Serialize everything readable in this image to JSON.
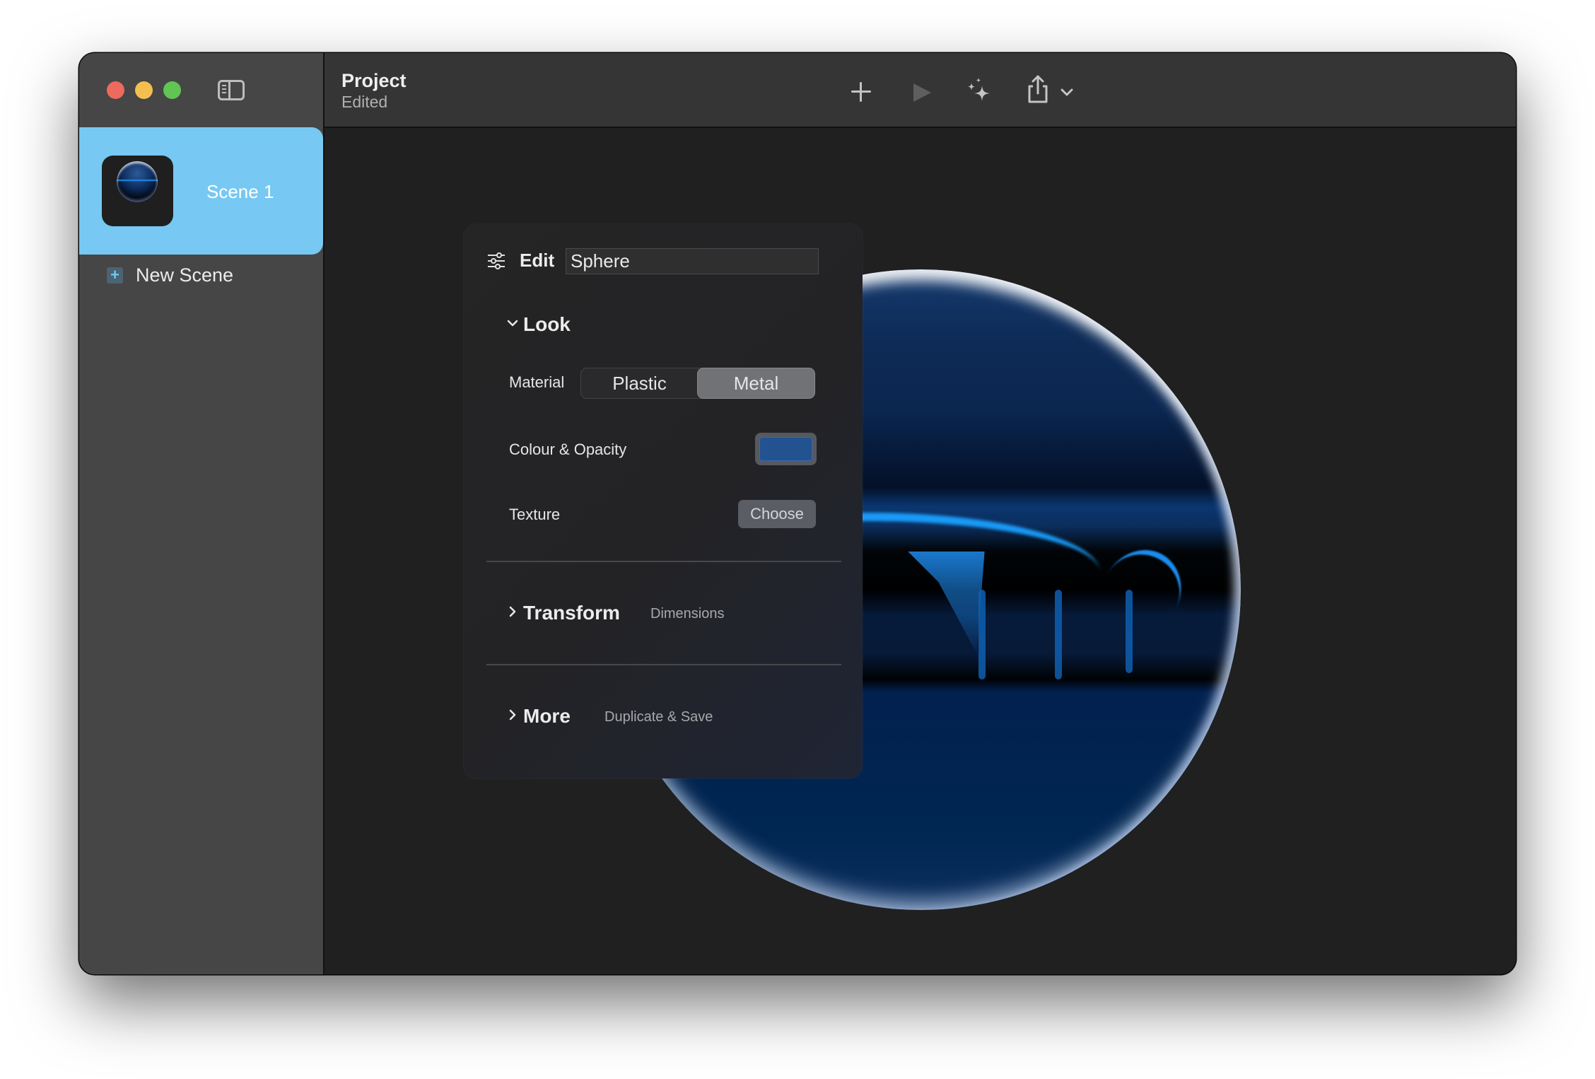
{
  "window": {
    "traffic_lights": [
      "close",
      "minimize",
      "maximize"
    ],
    "title": "Project",
    "subtitle": "Edited"
  },
  "sidebar": {
    "toggle_icon": "sidebar-icon",
    "scenes": [
      {
        "label": "Scene 1",
        "selected": true,
        "thumbnail": "blue-metal-sphere"
      }
    ],
    "new_scene_label": "New Scene"
  },
  "toolbar": {
    "items": [
      {
        "icon": "plus-icon",
        "label": "Add",
        "enabled": true
      },
      {
        "icon": "play-icon",
        "label": "Play",
        "enabled": false
      },
      {
        "icon": "sparkles-icon",
        "label": "Effects",
        "enabled": true
      },
      {
        "icon": "share-icon",
        "label": "Share",
        "enabled": true,
        "has_menu": true
      }
    ]
  },
  "edit_panel": {
    "header_icon": "sliders-icon",
    "header_label": "Edit",
    "object_name": "Sphere",
    "sections": {
      "look": {
        "title": "Look",
        "expanded": true,
        "material_label": "Material",
        "material_options": [
          "Plastic",
          "Metal"
        ],
        "material_selected": "Metal",
        "colour_label": "Colour & Opacity",
        "colour_value": "#22528f",
        "texture_label": "Texture",
        "texture_button": "Choose"
      },
      "transform": {
        "title": "Transform",
        "hint": "Dimensions",
        "expanded": false
      },
      "more": {
        "title": "More",
        "hint": "Duplicate & Save",
        "expanded": false
      }
    }
  },
  "colors": {
    "selection_accent": "#77c8f3",
    "sphere_color": "#22528f"
  }
}
